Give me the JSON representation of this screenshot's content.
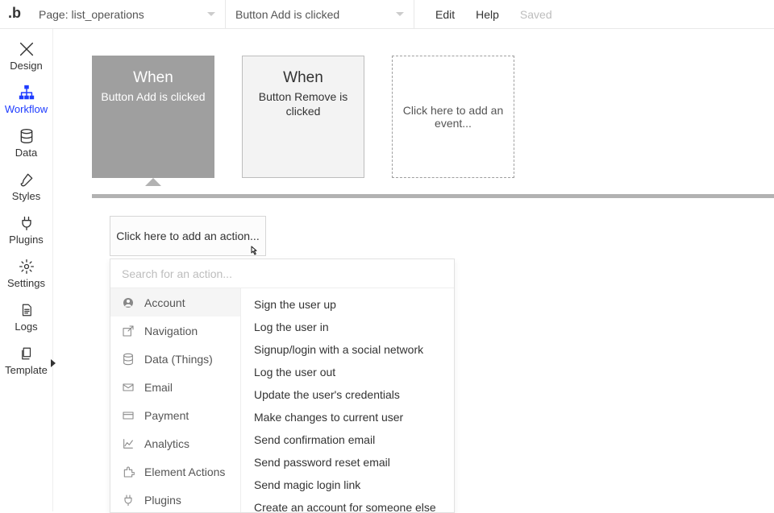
{
  "topbar": {
    "logo_text": ".b",
    "page_prefix": "Page: ",
    "page_name": "list_operations",
    "event_label": "Button Add is clicked",
    "links": {
      "edit": "Edit",
      "help": "Help",
      "saved": "Saved"
    }
  },
  "leftnav": [
    {
      "name": "design",
      "label": "Design",
      "icon": "pencil-cross"
    },
    {
      "name": "workflow",
      "label": "Workflow",
      "icon": "org-chart",
      "active": true
    },
    {
      "name": "data",
      "label": "Data",
      "icon": "database"
    },
    {
      "name": "styles",
      "label": "Styles",
      "icon": "paintbrush"
    },
    {
      "name": "plugins",
      "label": "Plugins",
      "icon": "plug"
    },
    {
      "name": "settings",
      "label": "Settings",
      "icon": "gear"
    },
    {
      "name": "logs",
      "label": "Logs",
      "icon": "doc-lines"
    },
    {
      "name": "template",
      "label": "Template",
      "icon": "doc-stack"
    }
  ],
  "events": [
    {
      "when": "When",
      "desc": "Button Add is clicked",
      "selected": true
    },
    {
      "when": "When",
      "desc": "Button Remove is clicked",
      "selected": false
    }
  ],
  "add_event_text": "Click here to add an event...",
  "add_action_text": "Click here to add an action...",
  "picker": {
    "search_placeholder": "Search for an action...",
    "categories": [
      {
        "label": "Account",
        "icon": "user-circle",
        "selected": true
      },
      {
        "label": "Navigation",
        "icon": "share-arrow"
      },
      {
        "label": "Data (Things)",
        "icon": "database"
      },
      {
        "label": "Email",
        "icon": "mail"
      },
      {
        "label": "Payment",
        "icon": "credit-card"
      },
      {
        "label": "Analytics",
        "icon": "chart-up"
      },
      {
        "label": "Element Actions",
        "icon": "puzzle"
      },
      {
        "label": "Plugins",
        "icon": "plug"
      }
    ],
    "actions": [
      "Sign the user up",
      "Log the user in",
      "Signup/login with a social network",
      "Log the user out",
      "Update the user's credentials",
      "Make changes to current user",
      "Send confirmation email",
      "Send password reset email",
      "Send magic login link",
      "Create an account for someone else"
    ]
  }
}
